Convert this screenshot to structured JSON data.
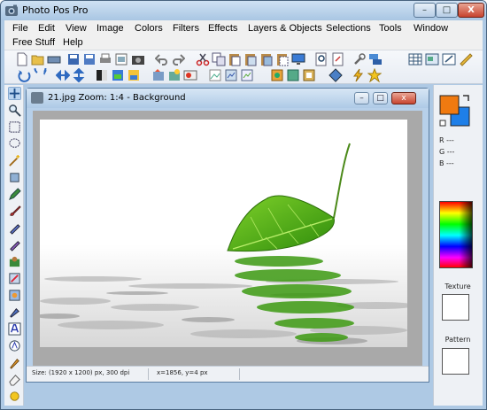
{
  "window": {
    "title": "Photo Pos Pro",
    "minimize": "–",
    "maximize": "□",
    "close": "X"
  },
  "menu": {
    "items": [
      "File",
      "Edit",
      "View",
      "Image",
      "Colors",
      "Filters",
      "Effects",
      "Layers & Objects",
      "Selections",
      "Tools",
      "Window",
      "Free Stuff",
      "Help"
    ]
  },
  "document": {
    "title": "21.jpg  Zoom: 1:4 - Background",
    "minimize": "–",
    "maximize": "□",
    "close": "x",
    "status_size": "Size: (1920 x 1200) px, 300 dpi",
    "status_coords": "x=1856, y=4 px"
  },
  "colors": {
    "foreground": "#f07a10",
    "background": "#1e7fe8",
    "accent_title": "#aec9e4"
  },
  "color_readout": {
    "r": "R ---",
    "g": "G ---",
    "b": "B ---"
  },
  "panels": {
    "texture_label": "Texture",
    "pattern_label": "Pattern"
  },
  "toolbar_icons": [
    "new-icon",
    "open-icon",
    "scan-icon",
    "save-icon",
    "save-as-icon",
    "print-icon",
    "preview-icon",
    "camera-icon",
    "undo-icon",
    "redo-icon",
    "cut-icon",
    "copy-icon",
    "paste-icon",
    "paste-new-icon",
    "paste-layer-icon",
    "monitor-icon",
    "zoom-page-icon",
    "zoom-fit-icon",
    "tools-icon",
    "layers-icon",
    "grid-icon",
    "screenshot-icon",
    "resize-icon",
    "ruler-icon",
    "rotate-left-icon",
    "rotate-right-icon",
    "flip-horizontal-icon",
    "flip-vertical-icon",
    "color-balance-icon",
    "levels-icon",
    "hue-icon",
    "filter-icon",
    "effect-icon",
    "picture-icon",
    "frame-icon",
    "layer-add-icon",
    "text-layer-icon",
    "object-icon",
    "selection-icon",
    "lightning-icon",
    "star-icon"
  ],
  "left_tools": [
    "move-icon",
    "zoom-icon",
    "rect-select-icon",
    "lasso-icon",
    "magic-wand-icon",
    "crop-icon",
    "pencil-icon",
    "brush-icon",
    "airbrush-icon",
    "clone-icon",
    "red-eye-icon",
    "fill-icon",
    "gradient-icon",
    "smudge-icon",
    "text-icon",
    "shape-icon",
    "dropper-icon",
    "eraser-icon",
    "color-replace-icon"
  ]
}
